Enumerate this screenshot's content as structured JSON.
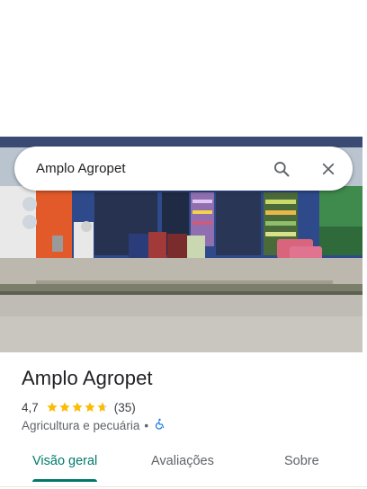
{
  "search": {
    "query": "Amplo Agropet"
  },
  "place": {
    "name": "Amplo Agropet",
    "rating": "4,7",
    "rating_value": 4.7,
    "stars_max": 5,
    "review_count": "(35)",
    "category": "Agricultura e pecuária",
    "separator": "•",
    "wheelchair_accessible": true
  },
  "tabs": [
    {
      "label": "Visão geral",
      "active": true
    },
    {
      "label": "Avaliações",
      "active": false
    },
    {
      "label": "Sobre",
      "active": false
    }
  ],
  "colors": {
    "accent": "#00796b",
    "star": "#fbbc04",
    "accessibility_icon": "#1a73e8"
  },
  "icons": {
    "search": "search-icon",
    "close": "close-icon",
    "accessibility": "wheelchair-accessible-icon"
  }
}
